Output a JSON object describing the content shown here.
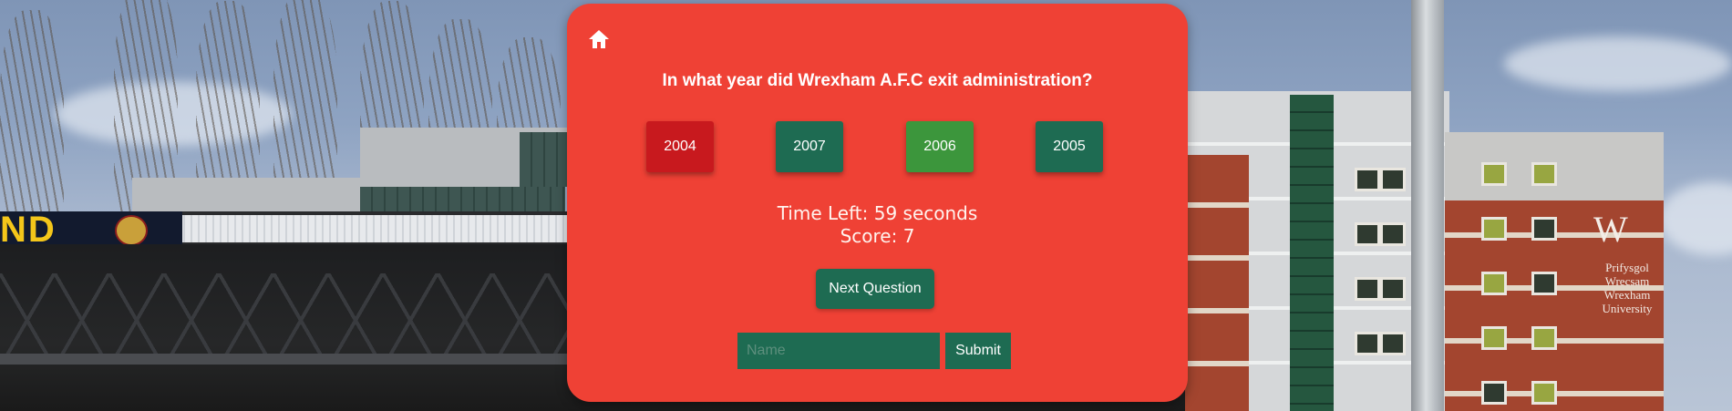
{
  "quiz": {
    "question": "In what year did Wrexham A.F.C exit administration?",
    "answers": [
      {
        "label": "2004",
        "color": "#c8191e"
      },
      {
        "label": "2007",
        "color": "#1e6b52"
      },
      {
        "label": "2006",
        "color": "#3c963c"
      },
      {
        "label": "2005",
        "color": "#1e6b52"
      }
    ],
    "time_left": "Time Left: 59 seconds",
    "score": "Score: 7",
    "next_label": "Next Question",
    "name_placeholder": "Name",
    "submit_label": "Submit",
    "home_icon": "home-icon"
  },
  "background": {
    "stand_text": "ND",
    "building_logo_letter": "W",
    "building_logo_text": "Prifysgol Wrecsam Wrexham University"
  },
  "colors": {
    "card": "#ef4135",
    "wrong_answer": "#c8191e",
    "correct_answer": "#3c963c",
    "neutral_button": "#1e6b52"
  }
}
